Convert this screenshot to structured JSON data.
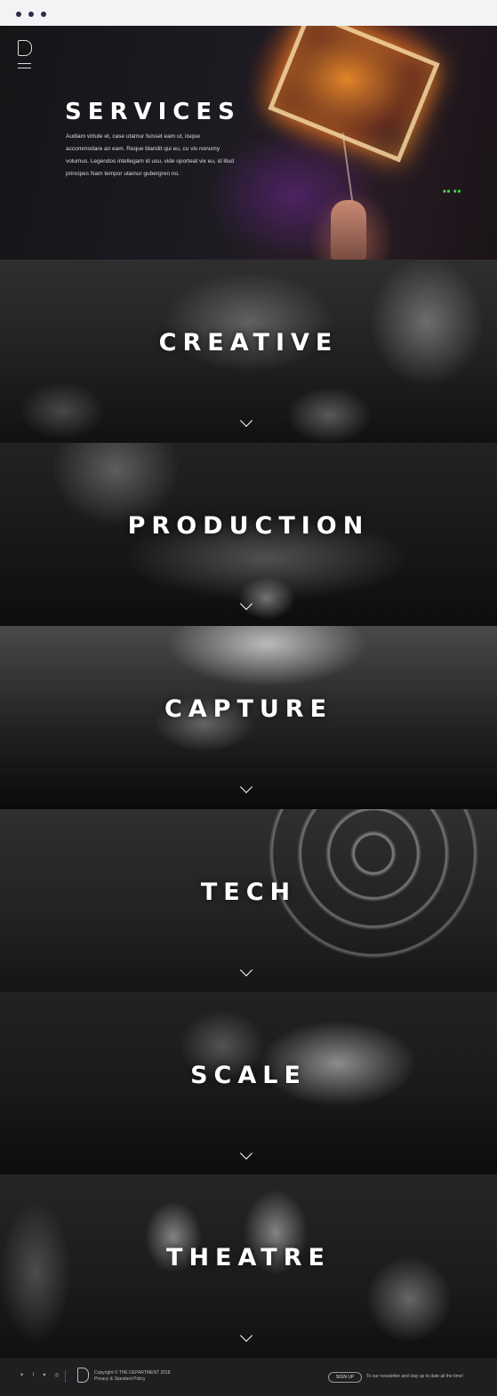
{
  "hero": {
    "title": "SERVICES",
    "description": "Audiam virtute et, case utamur fuisset eam ut, iisque accommodare an eam. Reque blandit qui eu, cu vis nonumy volumus. Legendos intellegam id usu, vide oporteat vix eu, id illud principes Nam tempor utamur gubergren no.",
    "marks": "■■ ■■"
  },
  "sections": [
    {
      "label": "CREATIVE"
    },
    {
      "label": "PRODUCTION"
    },
    {
      "label": "CAPTURE"
    },
    {
      "label": "TECH"
    },
    {
      "label": "SCALE"
    },
    {
      "label": "THEATRE"
    }
  ],
  "footer": {
    "socials": "✦ f ♥ ◎",
    "copyright_line1": "Copyright © THE DEPARTMENT 2018",
    "copyright_line2": "Privacy & Standard Policy",
    "signup_label": "SIGN UP",
    "newsletter_text": "To our newsletter and stay up to date all the time!"
  }
}
